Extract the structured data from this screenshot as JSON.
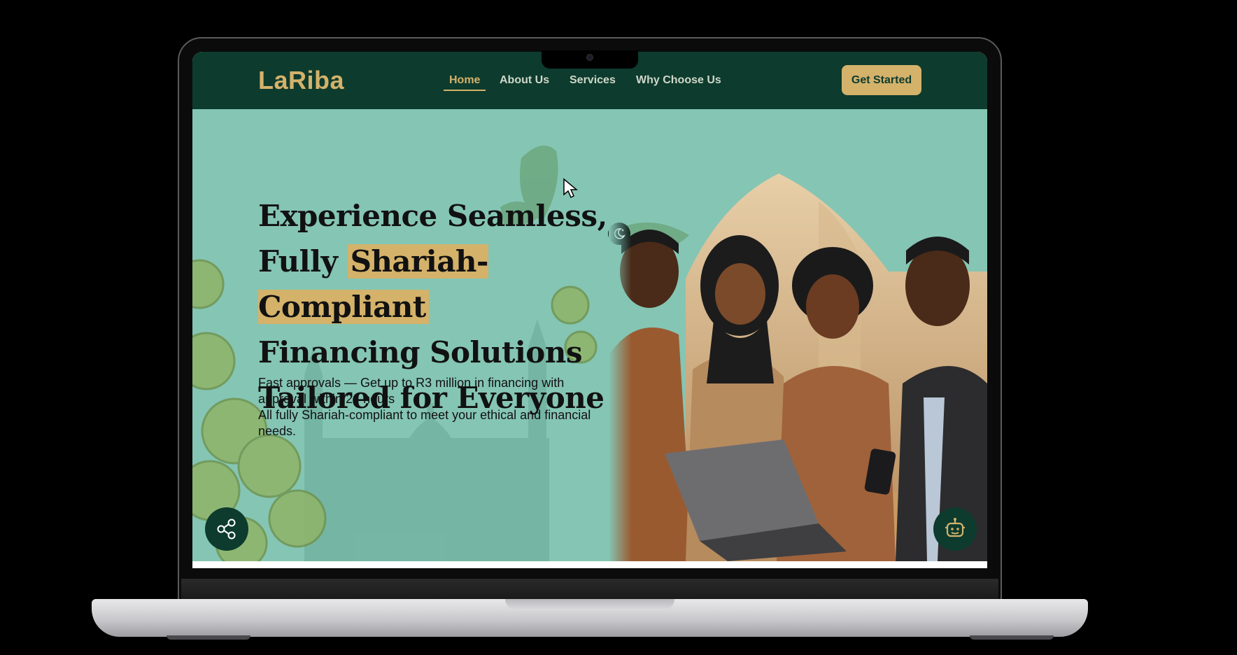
{
  "colors": {
    "nav_bg": "#0d3b2e",
    "accent_gold": "#d4b26a",
    "hero_bg": "#85c5b3",
    "text_dark": "#111111"
  },
  "nav": {
    "logo": "LaRiba",
    "links": [
      "Home",
      "About Us",
      "Services",
      "Why Choose Us"
    ],
    "active_link": "Home",
    "cta_label": "Get Started"
  },
  "hero": {
    "headline_part1": "Experience Seamless,",
    "headline_part2": "Fully ",
    "headline_highlight": "Shariah-Compliant",
    "headline_part3": "Financing Solutions",
    "headline_part4": "Tailored for Everyone",
    "subtext_line1": "Fast approvals — Get up to R3 million in financing with approval within 24 hours",
    "subtext_line2": "All fully Shariah-compliant to meet your ethical and financial needs."
  },
  "icons": {
    "theme_toggle": "moon-star-icon",
    "share": "share-icon",
    "chatbot": "chatbot-icon",
    "cursor": "mouse-cursor-icon"
  }
}
